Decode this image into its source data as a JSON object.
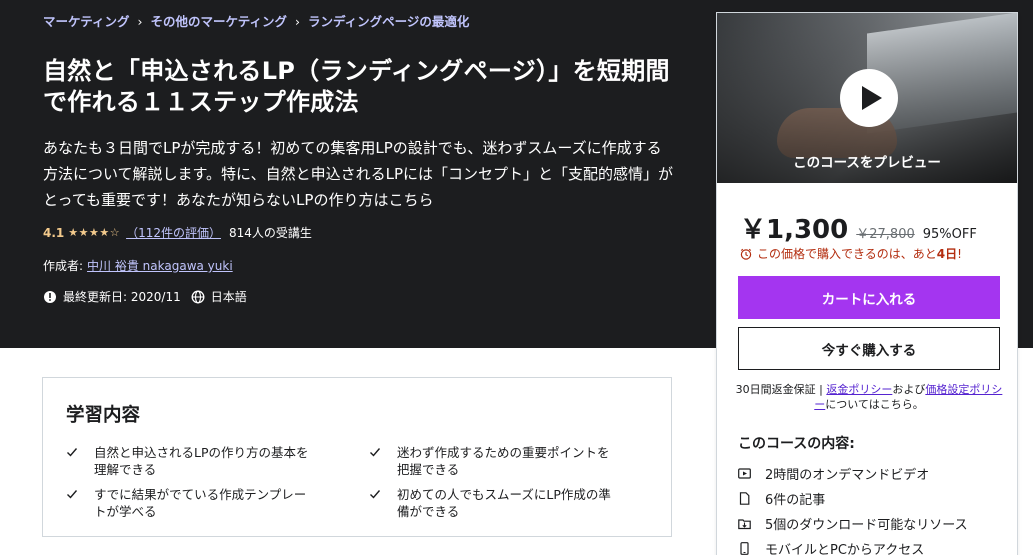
{
  "breadcrumb": [
    "マーケティング",
    "その他のマーケティング",
    "ランディングページの最適化"
  ],
  "breadcrumb_separator": "›",
  "course": {
    "title": "自然と「申込されるLP（ランディングページ）」を短期間で作れる１１ステップ作成法",
    "subtitle": "あなたも３日間でLPが完成する！初めての集客用LPの設計でも、迷わずスムーズに作成する方法について解説します。特に、自然と申込されるLPには「コンセプト」と「支配的感情」がとっても重要です！あなたが知らないLPの作り方はこちら",
    "rating": "4.1",
    "rating_value": 4.1,
    "stars": "★★★★☆",
    "reviews": "（112件の評価）",
    "students": "814人の受講生",
    "author_label": "作成者:",
    "author": "中川 裕貴 nakagawa yuki",
    "last_updated": "最終更新日: 2020/11",
    "language": "日本語"
  },
  "sidebar": {
    "preview_label": "このコースをプレビュー",
    "price": "￥1,300",
    "original_price": "￥27,800",
    "discount": "95%OFF",
    "urgency_text": "この価格で購入できるのは、あと",
    "urgency_days": "4日",
    "urgency_suffix": "!",
    "add_to_cart": "カートに入れる",
    "buy_now": "今すぐ購入する",
    "guarantee_prefix": "30日間返金保証 | ",
    "refund_policy": "返金ポリシー",
    "and": "および",
    "pricing_policy": "価格設定ポリシー",
    "guarantee_suffix": "についてはこちら。",
    "includes_title": "このコースの内容:",
    "includes": [
      {
        "icon": "video-icon",
        "label": "2時間のオンデマンドビデオ"
      },
      {
        "icon": "article-icon",
        "label": "6件の記事"
      },
      {
        "icon": "download-icon",
        "label": "5個のダウンロード可能なリソース"
      },
      {
        "icon": "mobile-icon",
        "label": "モバイルとPCからアクセス"
      }
    ]
  },
  "learn": {
    "title": "学習内容",
    "items": [
      "自然と申込されるLPの作り方の基本を理解できる",
      "迷わず作成するための重要ポイントを把握できる",
      "すでに結果がでている作成テンプレートが学べる",
      "初めての人でもスムーズにLP作成の準備ができる"
    ]
  },
  "colors": {
    "hero_bg": "#1c1d1f",
    "accent": "#a435f0",
    "link_light": "#c0c4fc",
    "star": "#f3ca8c",
    "urgency": "#b32d0f"
  }
}
